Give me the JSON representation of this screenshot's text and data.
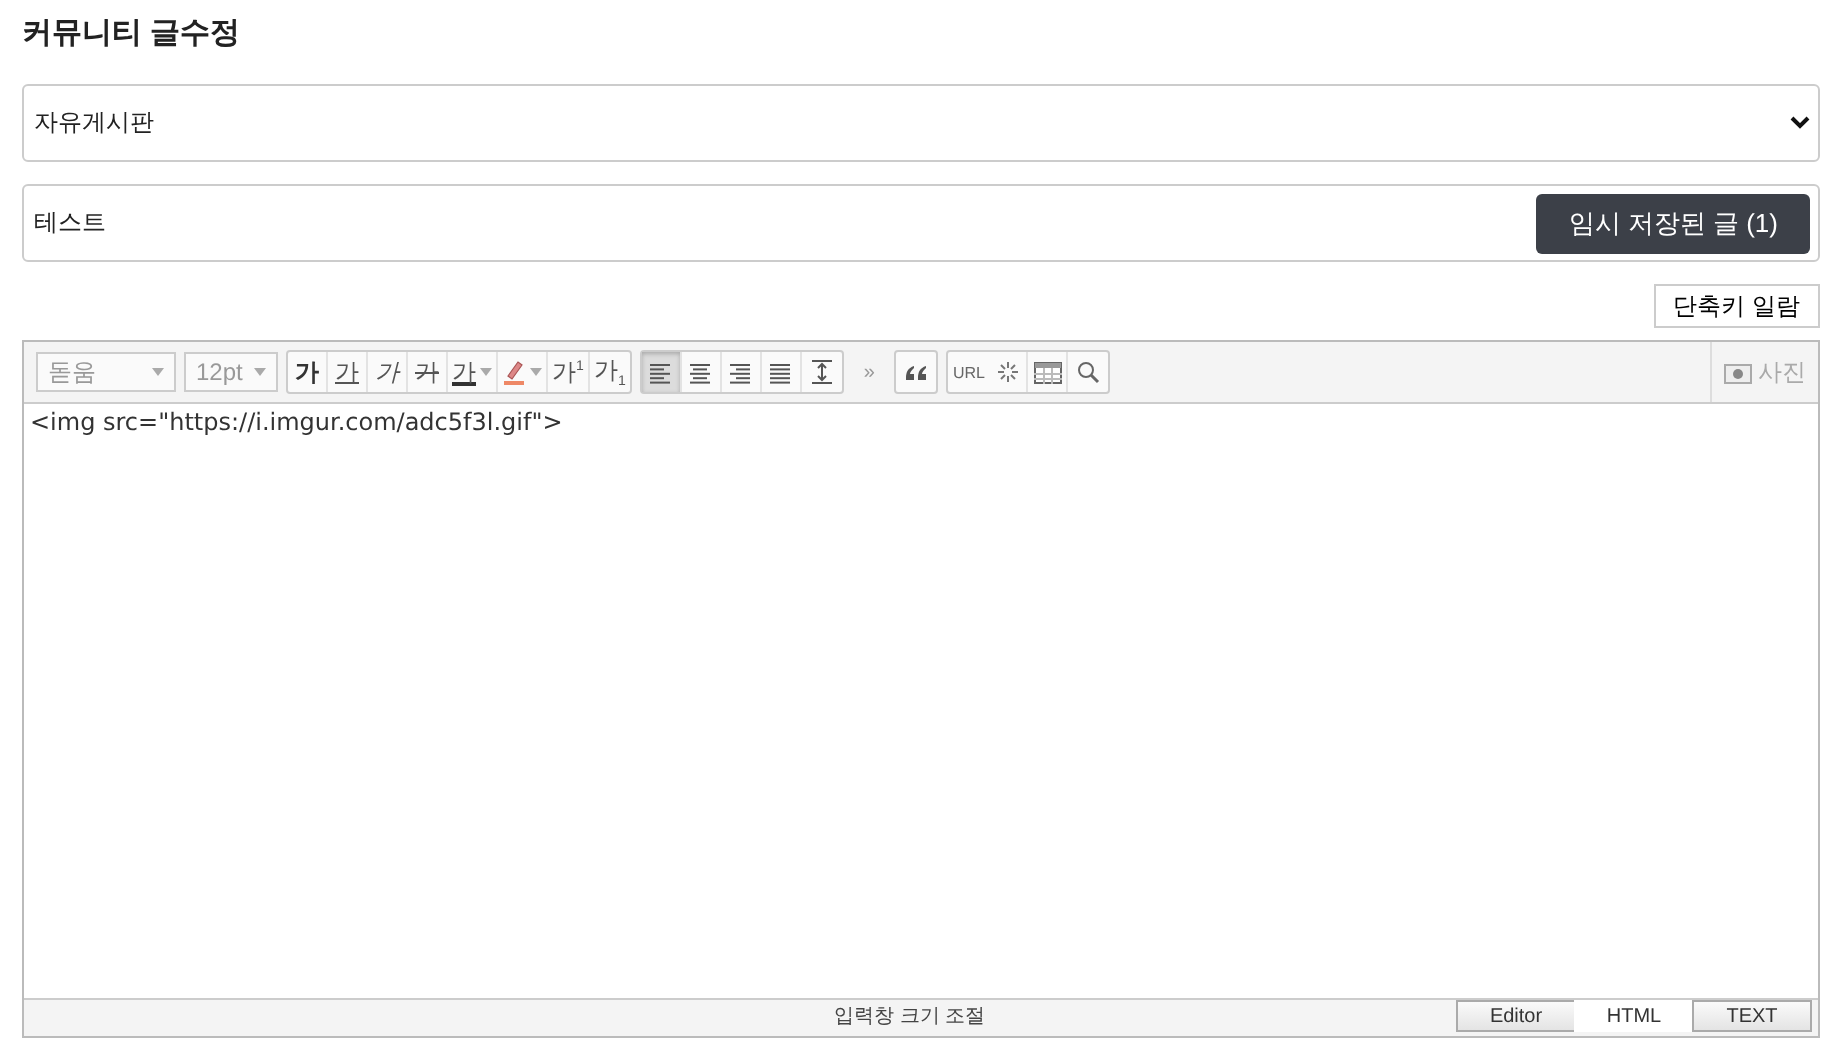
{
  "page_title": "커뮤니티 글수정",
  "board_select": {
    "value": "자유게시판"
  },
  "title_field": {
    "value": "테스트"
  },
  "draft_button": "임시 저장된 글 (1)",
  "shortcut_button": "단축키 일람",
  "toolbar": {
    "groups": [
      [
        {
          "kind": "select",
          "value": "돋움",
          "disabled": true
        }
      ],
      [
        {
          "kind": "select",
          "value": "12pt",
          "disabled": true
        }
      ],
      [
        {
          "kind": "bold",
          "label": "가"
        },
        {
          "kind": "underline",
          "label": "가"
        },
        {
          "kind": "italic",
          "label": "가"
        },
        {
          "kind": "strike",
          "label": "가"
        },
        {
          "kind": "color",
          "label": "가"
        },
        {
          "kind": "highlight"
        },
        {
          "kind": "plain",
          "label": "가$^{1}$"
        },
        {
          "kind": "plain",
          "label": "가$_{1}$"
        }
      ],
      [
        {
          "kind": "alignleft",
          "selected": true
        },
        {
          "kind": "aligncenter",
          "selected": false
        },
        {
          "kind": "alignright",
          "selected": false
        },
        {
          "kind": "justify",
          "selected": false
        },
        {
          "kind": "lineheight"
        }
      ],
      [
        {
          "kind": "char",
          "label": "»"
        }
      ],
      [
        {
          "kind": "quote"
        }
      ],
      [
        {
          "kind": "char",
          "label": "URL"
        },
        {
          "kind": "special"
        },
        {
          "kind": "table"
        },
        {
          "kind": "search"
        }
      ]
    ],
    "photo_button": "사진"
  },
  "editor_content": "<img src=\"https://i.imgur.com/adc5f3l.gif\">",
  "resize_bar": "입력창 크기 조절",
  "mode_tabs": [
    {
      "label": "Editor",
      "selected": false
    },
    {
      "label": "HTML",
      "selected": true
    },
    {
      "label": "TEXT",
      "selected": false
    }
  ]
}
